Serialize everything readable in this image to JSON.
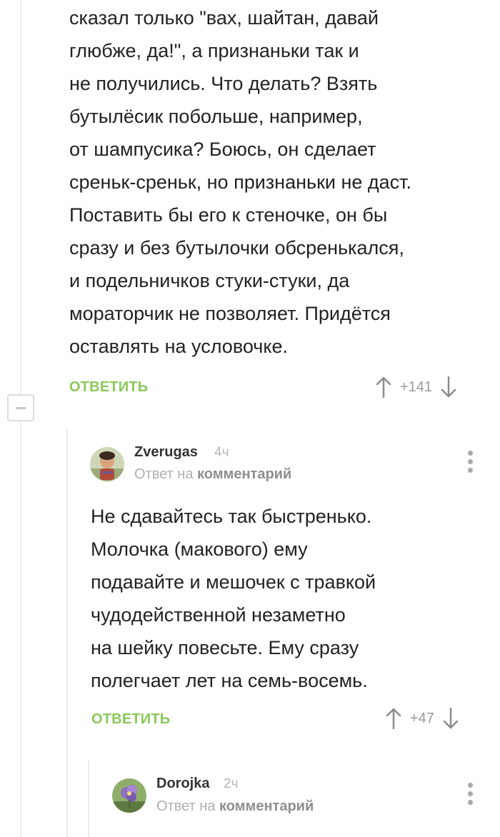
{
  "parent_comment": {
    "lines": [
      "сказал только \"вах, шайтан, давай",
      "глюбже, да!\", а признаньки так и",
      "не получились. Что делать? Взять",
      "бутылёсик побольше, например,",
      "от шампусика? Боюсь, он сделает",
      "среньк-среньк, но признаньки не даст.",
      "Поставить бы его к стеночке, он бы",
      "сразу и без бутылочки обсренькался,",
      "и подельничков стуки-стуки, да",
      "мораторчик не позволяет. Придётся",
      "оставлять на условочке."
    ],
    "reply_label": "ОТВЕТИТЬ",
    "score": "+141"
  },
  "reply1": {
    "author": "Zverugas",
    "time": "4ч",
    "reply_to_prefix": "Ответ на",
    "reply_to_link": "комментарий",
    "lines": [
      "Не сдавайтесь так быстренько.",
      "Молочка (макового) ему",
      "подавайте и мешочек с травкой",
      "чудодейственной незаметно",
      "на шейку повесьте. Ему сразу",
      "полегчает лет на семь-восемь."
    ],
    "reply_label": "ОТВЕТИТЬ",
    "score": "+47"
  },
  "reply2": {
    "author": "Dorojka",
    "time": "2ч",
    "reply_to_prefix": "Ответ на",
    "reply_to_link": "комментарий"
  },
  "colors": {
    "accent_green": "#8ac858",
    "muted": "#9a9a9a",
    "thread_line": "#ececec"
  },
  "icons": [
    "minus-icon",
    "arrow-up-icon",
    "arrow-down-icon",
    "more-vertical-icon",
    "avatar-image"
  ]
}
